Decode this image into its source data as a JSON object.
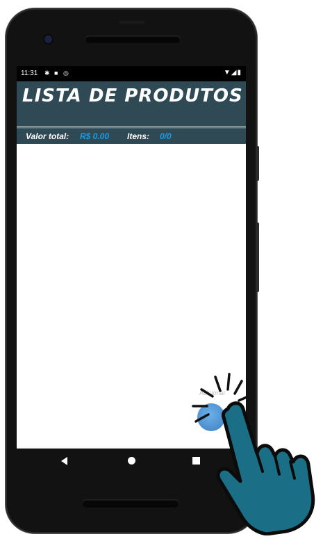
{
  "status_bar": {
    "time": "11:31"
  },
  "header": {
    "title": "LISTA DE PRODUTOS"
  },
  "summary": {
    "total_label": "Valor total:",
    "total_value": "R$ 0.00",
    "items_label": "Itens:",
    "items_value": "0/0"
  },
  "fab": {
    "label": "Adicionar"
  },
  "colors": {
    "header_bg": "#2f4955",
    "accent_value": "#1e9be0",
    "hand": "#1a6f87"
  },
  "icons": [
    "gear-icon",
    "sd-card-icon",
    "sync-icon",
    "wifi-icon",
    "signal-icon",
    "battery-icon",
    "nav-back-icon",
    "nav-home-icon",
    "nav-recent-icon",
    "tap-hand-icon"
  ]
}
